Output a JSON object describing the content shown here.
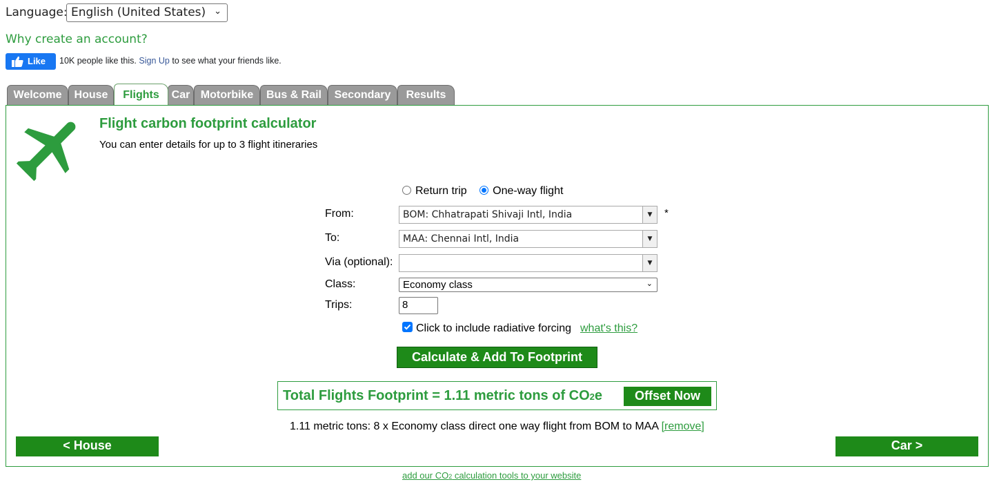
{
  "language": {
    "label": "Language:",
    "selected": "English (United States)"
  },
  "account_link": "Why create an account?",
  "facebook": {
    "like_label": "Like",
    "count_text": "10K people like this.",
    "signup_link": "Sign Up",
    "suffix_text": "to see what your friends like."
  },
  "tabs": [
    {
      "label": "Welcome",
      "active": false
    },
    {
      "label": "House",
      "active": false
    },
    {
      "label": "Flights",
      "active": true
    },
    {
      "label": "Car",
      "active": false
    },
    {
      "label": "Motorbike",
      "active": false
    },
    {
      "label": "Bus & Rail",
      "active": false
    },
    {
      "label": "Secondary",
      "active": false
    },
    {
      "label": "Results",
      "active": false
    }
  ],
  "panel": {
    "icon": "airplane-icon",
    "title": "Flight carbon footprint calculator",
    "subtitle": "You can enter details for up to 3 flight itineraries"
  },
  "form": {
    "trip_type": {
      "options": [
        "Return trip",
        "One-way flight"
      ],
      "selected": "One-way flight"
    },
    "from": {
      "label": "From:",
      "value": "BOM: Chhatrapati Shivaji Intl, India",
      "required_mark": "*"
    },
    "to": {
      "label": "To:",
      "value": "MAA: Chennai Intl, India"
    },
    "via": {
      "label": "Via (optional):",
      "value": ""
    },
    "class": {
      "label": "Class:",
      "value": "Economy class"
    },
    "trips": {
      "label": "Trips:",
      "value": "8"
    },
    "radiative_forcing": {
      "checked": true,
      "label": "Click to include radiative forcing",
      "help_link": "what's this?"
    },
    "calculate_button": "Calculate & Add To Footprint"
  },
  "total": {
    "text_prefix": "Total Flights Footprint = 1.11 metric tons of CO",
    "text_sub": "2",
    "text_suffix": "e",
    "offset_button": "Offset Now"
  },
  "summary": {
    "text": "1.11 metric tons: 8 x Economy class direct one way flight from BOM to MAA",
    "remove_link": "[remove]"
  },
  "nav": {
    "prev_button": "< House",
    "next_button": "Car >"
  },
  "footer": {
    "link_prefix": "add our CO",
    "link_sub": "2",
    "link_suffix": " calculation tools to your website"
  },
  "colors": {
    "brand_green": "#2d9c3e",
    "button_green": "#1e8a19",
    "tab_gray": "#9a9a9a",
    "facebook_blue": "#1877f2",
    "checkbox_blue": "#0075ff"
  }
}
